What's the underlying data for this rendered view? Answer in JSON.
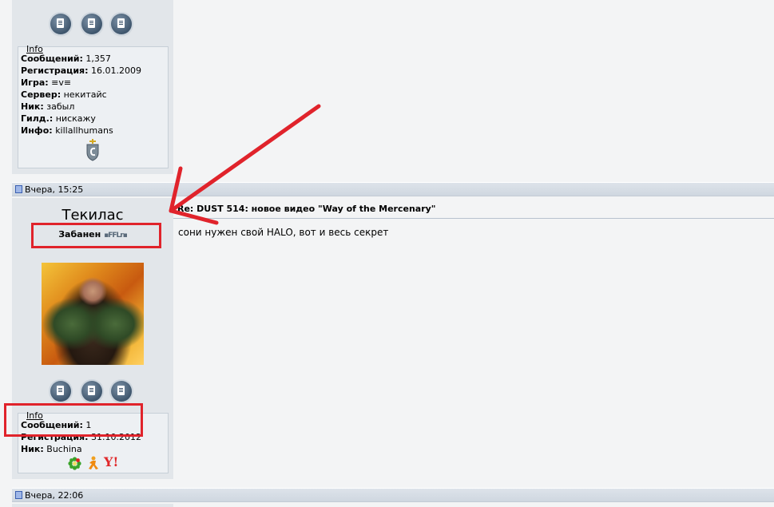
{
  "post1": {
    "info": {
      "title": "Info",
      "rows": [
        {
          "label": "Сообщений:",
          "value": "1,357"
        },
        {
          "label": "Регистрация:",
          "value": "16.01.2009"
        },
        {
          "label": "Игра:",
          "value": "≡v≡"
        },
        {
          "label": "Сервер:",
          "value": "некитайс"
        },
        {
          "label": "Ник:",
          "value": "забыл"
        },
        {
          "label": "Гилд.:",
          "value": "нискажу"
        },
        {
          "label": "Инфо:",
          "value": "killallhumans"
        }
      ]
    }
  },
  "post2": {
    "date": "Вчера, 15:25",
    "username": "Текилас",
    "status_label": "Забанен",
    "status_badge": "▪FFLr▪",
    "subject": "Re: DUST 514: новое видео \"Way of the Mercenary\"",
    "message": "сони нужен свой HALO, вот и весь секрет",
    "info": {
      "title": "Info",
      "rows": [
        {
          "label": "Сообщений:",
          "value": "1"
        },
        {
          "label": "Регистрация:",
          "value": "31.10.2012"
        },
        {
          "label": "Ник:",
          "value": "Buchina"
        }
      ]
    }
  },
  "post3": {
    "date": "Вчера, 22:06"
  },
  "annotation": {
    "arrow_color": "#e0232b",
    "box_color": "#e0232b"
  }
}
